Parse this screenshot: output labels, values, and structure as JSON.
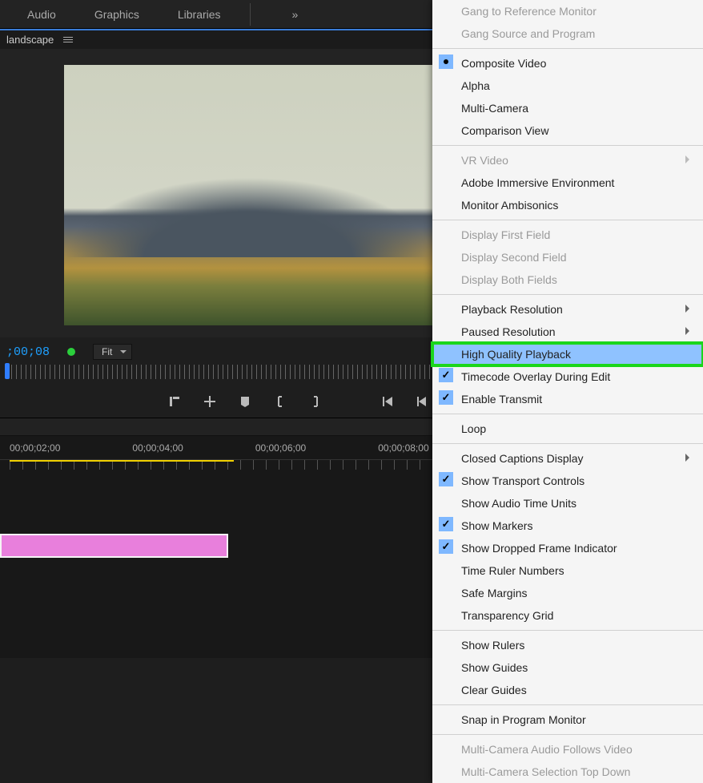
{
  "top_menu": {
    "audio": "Audio",
    "graphics": "Graphics",
    "libraries": "Libraries",
    "more": "»"
  },
  "panel": {
    "title": "landscape"
  },
  "controls": {
    "timecode": ";00;08",
    "fit": "Fit"
  },
  "timeline": {
    "times": [
      "00;00;02;00",
      "00;00;04;00",
      "00;00;06;00",
      "00;00;08;00"
    ]
  },
  "menu": {
    "gang_ref": "Gang to Reference Monitor",
    "gang_src": "Gang Source and Program",
    "composite": "Composite Video",
    "alpha": "Alpha",
    "multi_cam": "Multi-Camera",
    "comparison": "Comparison View",
    "vr": "VR Video",
    "immersive": "Adobe Immersive Environment",
    "ambisonics": "Monitor Ambisonics",
    "disp_first": "Display First Field",
    "disp_second": "Display Second Field",
    "disp_both": "Display Both Fields",
    "pb_res": "Playback Resolution",
    "pause_res": "Paused Resolution",
    "hq": "High Quality Playback",
    "tc_overlay": "Timecode Overlay During Edit",
    "transmit": "Enable Transmit",
    "loop": "Loop",
    "cc": "Closed Captions Display",
    "transport": "Show Transport Controls",
    "audio_time": "Show Audio Time Units",
    "markers": "Show Markers",
    "dropped": "Show Dropped Frame Indicator",
    "time_ruler": "Time Ruler Numbers",
    "safe": "Safe Margins",
    "transparency": "Transparency Grid",
    "rulers": "Show Rulers",
    "guides": "Show Guides",
    "clear_guides": "Clear Guides",
    "snap": "Snap in Program Monitor",
    "mc_audio": "Multi-Camera Audio Follows Video",
    "mc_top": "Multi-Camera Selection Top Down"
  }
}
